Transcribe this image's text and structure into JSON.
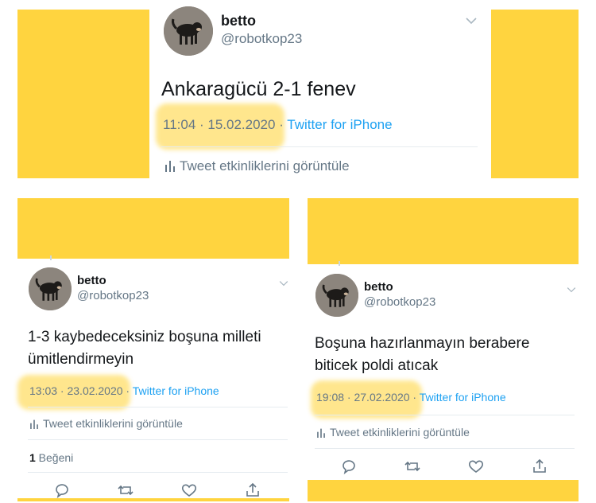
{
  "tweet1": {
    "name": "betto",
    "handle": "@robotkop23",
    "text": "Ankaragücü 2-1 fenev",
    "time": "11:04 · 15.02.2020",
    "sep": " · ",
    "source": "Twitter for iPhone",
    "activity": "Tweet etkinliklerini görüntüle"
  },
  "tweet2": {
    "name": "betto",
    "handle": "@robotkop23",
    "text_line1": "1-3 kaybedeceksiniz boşuna milleti",
    "text_line2": "ümitlendirmeyin",
    "time": "13:03 · 23.02.2020",
    "sep": " · ",
    "source": "Twitter for iPhone",
    "activity": "Tweet etkinliklerini görüntüle",
    "likes_count": "1",
    "likes_label": " Beğeni"
  },
  "tweet3": {
    "name": "betto",
    "handle": "@robotkop23",
    "text_line1": "Boşuna hazırlanmayın berabere",
    "text_line2": "biticek poldi atıcak",
    "time": "19:08 · 27.02.2020",
    "sep": " · ",
    "source": "Twitter for iPhone",
    "activity": "Tweet etkinliklerini görüntüle"
  },
  "colors": {
    "yellow": "#ffd43f",
    "link": "#1da1f2",
    "muted": "#657786"
  },
  "icons": [
    "dog-avatar",
    "chevron-down-icon",
    "analytics-icon",
    "reply-icon",
    "retweet-icon",
    "like-icon",
    "share-icon"
  ]
}
